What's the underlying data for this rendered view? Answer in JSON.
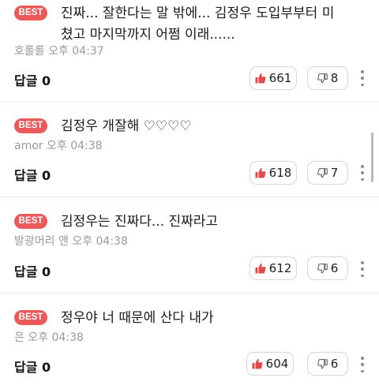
{
  "colors": {
    "best_badge": "#ea5a5a",
    "thumb_up": "#e24a4a",
    "thumb_down": "#555555",
    "meta_text": "#9a9a9a"
  },
  "icons": {
    "upvote": "thumb-up-icon",
    "downvote": "thumb-down-icon",
    "more": "more-vertical-icon"
  },
  "comments": [
    {
      "badge": "BEST",
      "text": "진짜... 잘한다는 말 밖에... 김정우 도입부부터 미쳤고 마지막까지 어쩜 이래......",
      "author": "호롤롤",
      "time": "오후 04:37",
      "reply_label": "답글 0",
      "upvotes": "661",
      "downvotes": "8"
    },
    {
      "badge": "BEST",
      "text": "김정우 개잘해 ♡♡♡♡",
      "author": "amor",
      "time": "오후 04:38",
      "reply_label": "답글 0",
      "upvotes": "618",
      "downvotes": "7"
    },
    {
      "badge": "BEST",
      "text": "김정우는 진짜다... 진짜라고",
      "author": "발광머리 앤",
      "time": "오후 04:38",
      "reply_label": "답글 0",
      "upvotes": "612",
      "downvotes": "6"
    },
    {
      "badge": "BEST",
      "text": "정우야 너 때문에 산다 내가",
      "author": "은",
      "time": "오후 04:38",
      "reply_label": "답글 0",
      "upvotes": "604",
      "downvotes": "6"
    }
  ]
}
